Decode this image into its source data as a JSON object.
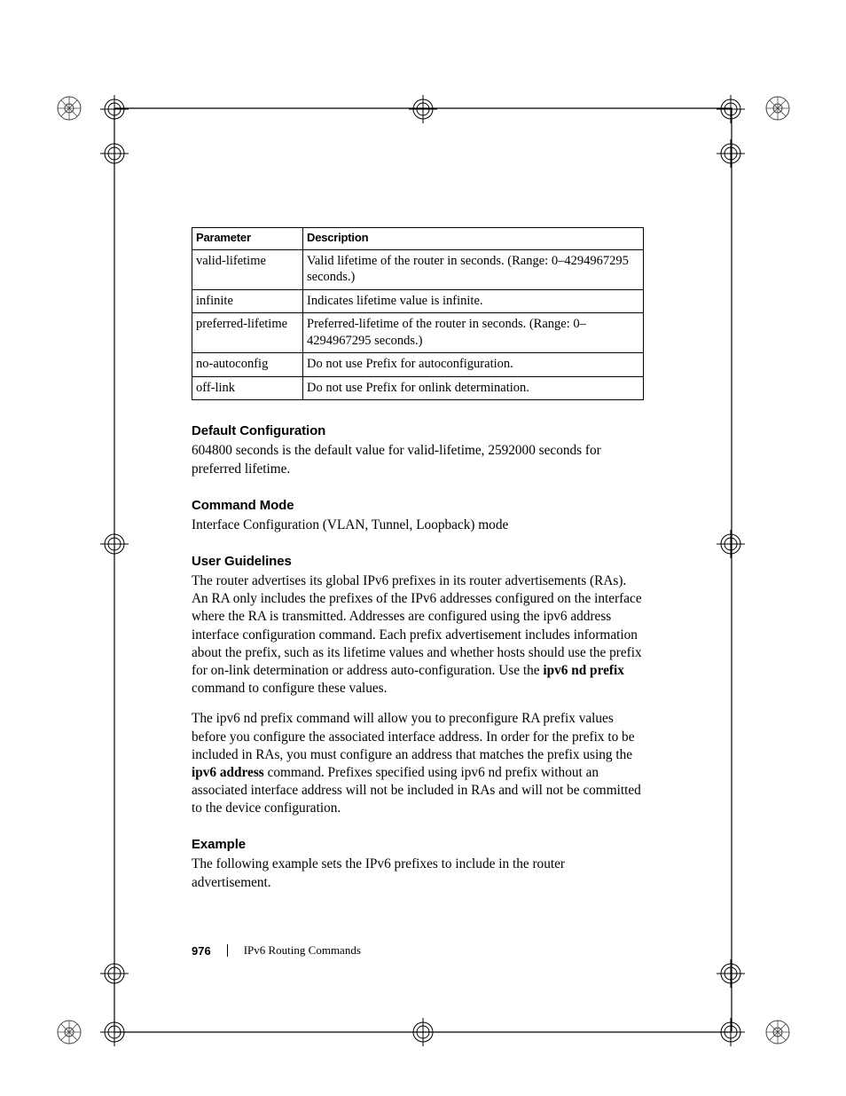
{
  "table": {
    "headers": {
      "param": "Parameter",
      "desc": "Description"
    },
    "rows": [
      {
        "param": "valid-lifetime",
        "desc": "Valid lifetime of the router in seconds. (Range: 0–4294967295 seconds.)"
      },
      {
        "param": "infinite",
        "desc": "Indicates lifetime value is infinite."
      },
      {
        "param": "preferred-lifetime",
        "desc": "Preferred-lifetime of the router in seconds. (Range: 0–4294967295 seconds.)"
      },
      {
        "param": "no-autoconfig",
        "desc": "Do not use Prefix for autoconfiguration."
      },
      {
        "param": "off-link",
        "desc": "Do not use Prefix for onlink determination."
      }
    ]
  },
  "sections": {
    "default_config": {
      "heading": "Default Configuration",
      "body": "604800 seconds is the default value for valid-lifetime, 2592000 seconds for preferred lifetime."
    },
    "command_mode": {
      "heading": "Command Mode",
      "body": "Interface Configuration (VLAN, Tunnel, Loopback) mode"
    },
    "user_guidelines": {
      "heading": "User Guidelines",
      "p1_pre": "The router advertises its global IPv6 prefixes in its router advertisements (RAs). An RA only includes the prefixes of the IPv6 addresses configured on the interface where the RA is transmitted. Addresses are configured using the ipv6 address interface configuration command. Each prefix advertisement includes information about the prefix, such as its lifetime values and whether hosts should use the prefix for on-link determination or address auto-configuration. Use the ",
      "p1_bold": "ipv6 nd prefix",
      "p1_post": " command to configure these values.",
      "p2_pre": "The ipv6 nd prefix command will allow you to preconfigure RA prefix values before you configure the associated interface address. In order for the prefix to be included in RAs, you must configure an address that matches the prefix using the ",
      "p2_bold": "ipv6 address",
      "p2_post": " command. Prefixes specified using ipv6 nd prefix without an associated interface address will not be included in RAs and will not be committed to the device configuration."
    },
    "example": {
      "heading": "Example",
      "body": "The following example sets the IPv6 prefixes to include in the router advertisement."
    }
  },
  "footer": {
    "page_number": "976",
    "chapter": "IPv6 Routing Commands"
  }
}
